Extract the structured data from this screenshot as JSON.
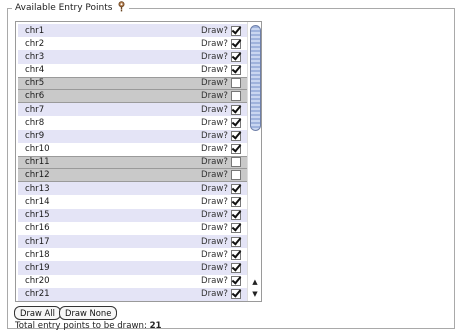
{
  "panel": {
    "legend": "Available Entry Points",
    "help_icon": "help-icon"
  },
  "entries": [
    {
      "name": "chr1",
      "draw_label": "Draw?",
      "checked": true
    },
    {
      "name": "chr2",
      "draw_label": "Draw?",
      "checked": true
    },
    {
      "name": "chr3",
      "draw_label": "Draw?",
      "checked": true
    },
    {
      "name": "chr4",
      "draw_label": "Draw?",
      "checked": true
    },
    {
      "name": "chr5",
      "draw_label": "Draw?",
      "checked": false
    },
    {
      "name": "chr6",
      "draw_label": "Draw?",
      "checked": false
    },
    {
      "name": "chr7",
      "draw_label": "Draw?",
      "checked": true
    },
    {
      "name": "chr8",
      "draw_label": "Draw?",
      "checked": true
    },
    {
      "name": "chr9",
      "draw_label": "Draw?",
      "checked": true
    },
    {
      "name": "chr10",
      "draw_label": "Draw?",
      "checked": true
    },
    {
      "name": "chr11",
      "draw_label": "Draw?",
      "checked": false
    },
    {
      "name": "chr12",
      "draw_label": "Draw?",
      "checked": false
    },
    {
      "name": "chr13",
      "draw_label": "Draw?",
      "checked": true
    },
    {
      "name": "chr14",
      "draw_label": "Draw?",
      "checked": true
    },
    {
      "name": "chr15",
      "draw_label": "Draw?",
      "checked": true
    },
    {
      "name": "chr16",
      "draw_label": "Draw?",
      "checked": true
    },
    {
      "name": "chr17",
      "draw_label": "Draw?",
      "checked": true
    },
    {
      "name": "chr18",
      "draw_label": "Draw?",
      "checked": true
    },
    {
      "name": "chr19",
      "draw_label": "Draw?",
      "checked": true
    },
    {
      "name": "chr20",
      "draw_label": "Draw?",
      "checked": true
    },
    {
      "name": "chr21",
      "draw_label": "Draw?",
      "checked": true
    }
  ],
  "buttons": {
    "draw_all": "Draw All",
    "draw_none": "Draw None"
  },
  "summary": {
    "label": "Total entry points to be drawn:",
    "count": "21"
  },
  "colors": {
    "row_even": "#e4e4f6",
    "row_odd": "#ffffff",
    "row_unchecked": "#c9c9c9"
  },
  "icons": {
    "scroll_up": "▲",
    "scroll_down": "▼"
  }
}
